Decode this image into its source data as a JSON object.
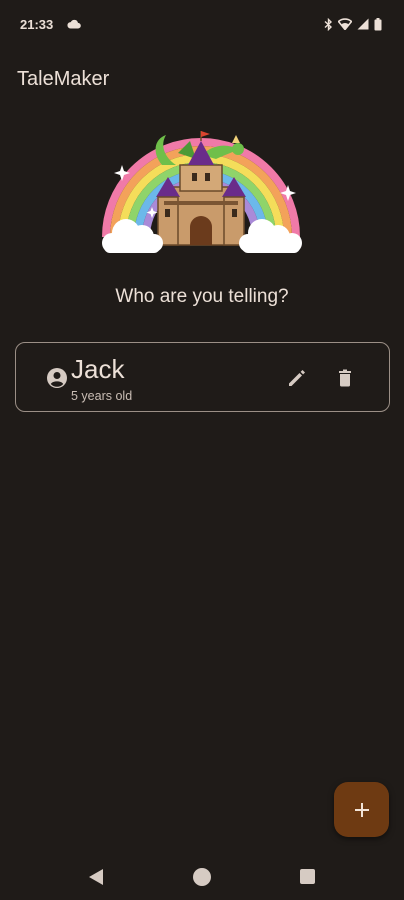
{
  "status_bar": {
    "time": "21:33",
    "icons": [
      "cloud-icon",
      "bluetooth-icon",
      "wifi-icon",
      "signal-icon",
      "battery-icon"
    ]
  },
  "app": {
    "title": "TaleMaker"
  },
  "hero": {
    "image_semantic": "castle-rainbow-dragon-illustration"
  },
  "prompt": "Who are you telling?",
  "profiles": [
    {
      "name": "Jack",
      "age_text": "5 years old",
      "icons": [
        "account-circle-icon",
        "pencil-icon",
        "trash-icon"
      ]
    }
  ],
  "fab": {
    "icon": "plus-icon",
    "color": "#6e3a12"
  },
  "nav_bar": {
    "icons": [
      "back-triangle-icon",
      "home-circle-icon",
      "recents-square-icon"
    ]
  },
  "colors": {
    "background": "#1f1b18",
    "text": "#ece0d7",
    "card_border": "#9b8f86",
    "accent": "#6e3a12"
  }
}
